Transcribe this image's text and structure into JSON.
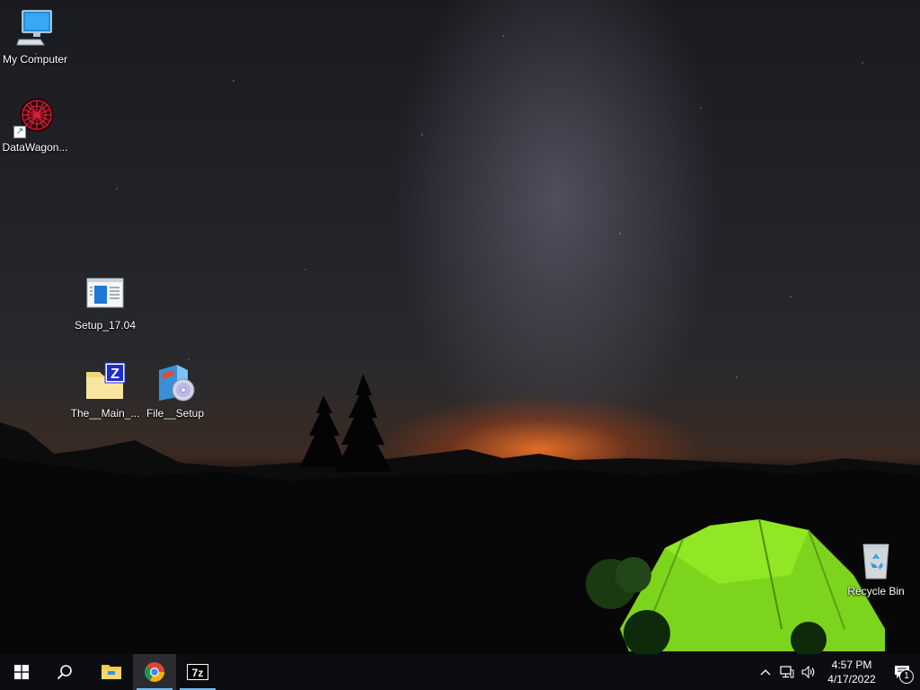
{
  "desktop": {
    "icons": [
      {
        "label": "My Computer",
        "icon": "computer-icon"
      },
      {
        "label": "DataWagon...",
        "icon": "datawagon-icon"
      },
      {
        "label": "Setup_17.04",
        "icon": "setup-window-icon"
      },
      {
        "label": "The__Main_...",
        "icon": "zip-folder-icon"
      },
      {
        "label": "File__Setup",
        "icon": "installer-icon"
      },
      {
        "label": "Recycle Bin",
        "icon": "recycle-bin-icon"
      }
    ]
  },
  "taskbar": {
    "buttons": [
      {
        "name": "start",
        "icon": "windows-logo-icon"
      },
      {
        "name": "search",
        "icon": "search-icon"
      },
      {
        "name": "file-explorer",
        "icon": "folder-icon"
      },
      {
        "name": "chrome",
        "icon": "chrome-icon"
      },
      {
        "name": "7zip",
        "icon": "7zip-icon",
        "text": "7z"
      }
    ],
    "tray": {
      "icons": [
        "chevron-up-icon",
        "network-icon",
        "volume-icon"
      ],
      "time": "4:57 PM",
      "date": "4/17/2022",
      "notification_count": "1"
    }
  }
}
